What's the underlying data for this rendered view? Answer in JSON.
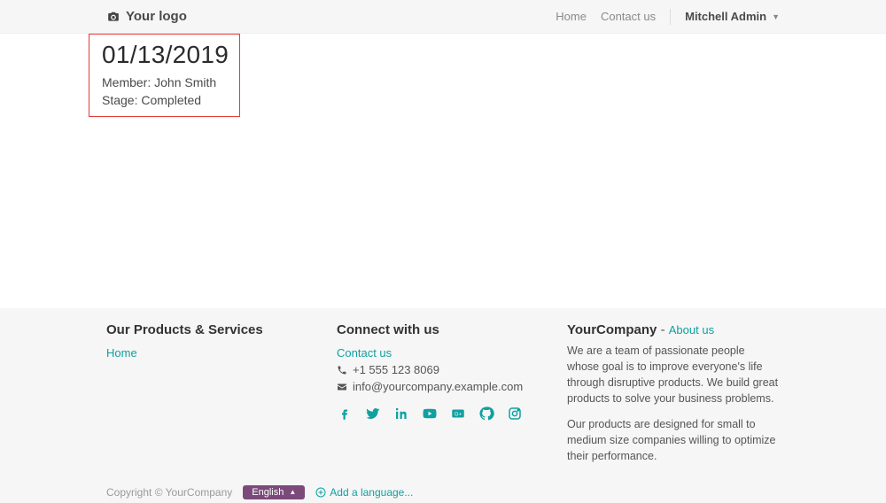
{
  "header": {
    "logo_text": "Your logo",
    "nav": {
      "home": "Home",
      "contact": "Contact us"
    },
    "user": "Mitchell Admin"
  },
  "record": {
    "date": "01/13/2019",
    "member_label": "Member:",
    "member_value": "John Smith",
    "stage_label": "Stage:",
    "stage_value": "Completed"
  },
  "footer": {
    "products_heading": "Our Products & Services",
    "products_link": "Home",
    "connect_heading": "Connect with us",
    "contact_link": "Contact us",
    "phone": "+1 555 123 8069",
    "email": "info@yourcompany.example.com",
    "about_name": "YourCompany",
    "about_dash": " - ",
    "about_link": "About us",
    "about_para1": "We are a team of passionate people whose goal is to improve everyone's life through disruptive products. We build great products to solve your business problems.",
    "about_para2": "Our products are designed for small to medium size companies willing to optimize their performance."
  },
  "bottom": {
    "copyright": "Copyright © YourCompany",
    "language": "English",
    "add_language": "Add a language..."
  }
}
